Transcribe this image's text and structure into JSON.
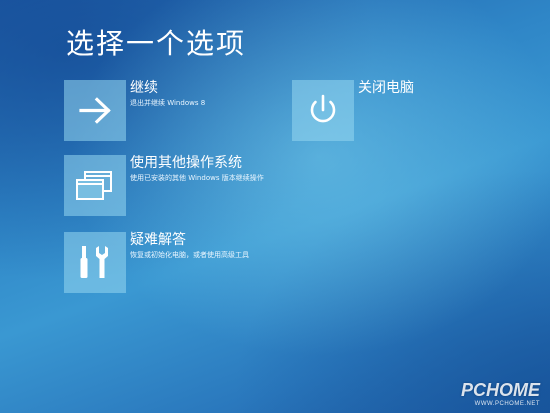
{
  "screen": {
    "title": "选择一个选项"
  },
  "options": [
    {
      "id": "continue",
      "label": "继续",
      "description": "退出并继续 Windows 8",
      "icon": "arrow-right-icon"
    },
    {
      "id": "other-os",
      "label": "使用其他操作系统",
      "description": "使用已安装的其他 Windows 版本继续操作",
      "icon": "windows-stack-icon"
    },
    {
      "id": "troubleshoot",
      "label": "疑难解答",
      "description": "恢复或初始化电脑，或者使用高级工具",
      "icon": "tools-icon"
    },
    {
      "id": "shutdown",
      "label": "关闭电脑",
      "description": "",
      "icon": "power-icon"
    }
  ],
  "watermark": {
    "logo": "PCHOME",
    "url": "WWW.PCHOME.NET"
  },
  "colors": {
    "background": "#2f86c7",
    "tile": "#96d7f0",
    "text": "#ffffff"
  }
}
